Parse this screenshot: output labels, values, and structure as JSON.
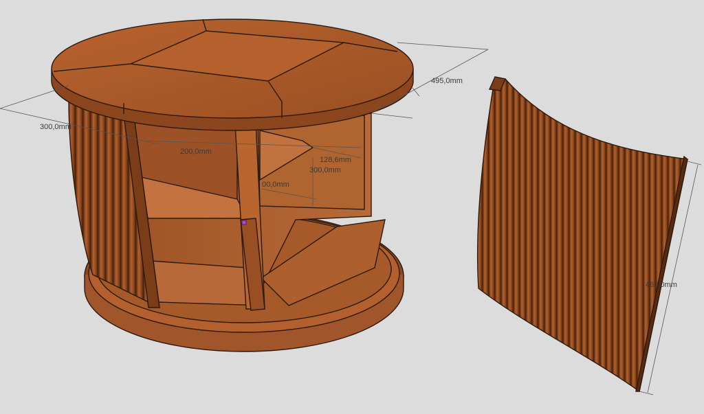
{
  "viewport": {
    "background": "#dcdcdc",
    "wood_colors": {
      "base": "#a8582a",
      "light": "#c06a34",
      "dark": "#6f3616",
      "edge": "#2a1a0e"
    }
  },
  "dimensions": {
    "top_diameter": "495,0mm",
    "outer_depth": "300,0mm",
    "shelf_width": "200,0mm",
    "shelf_depth": "128,6mm",
    "inner_height": "300,0mm",
    "inner_partial": "00,0mm",
    "panel_height": "465,0mm"
  }
}
